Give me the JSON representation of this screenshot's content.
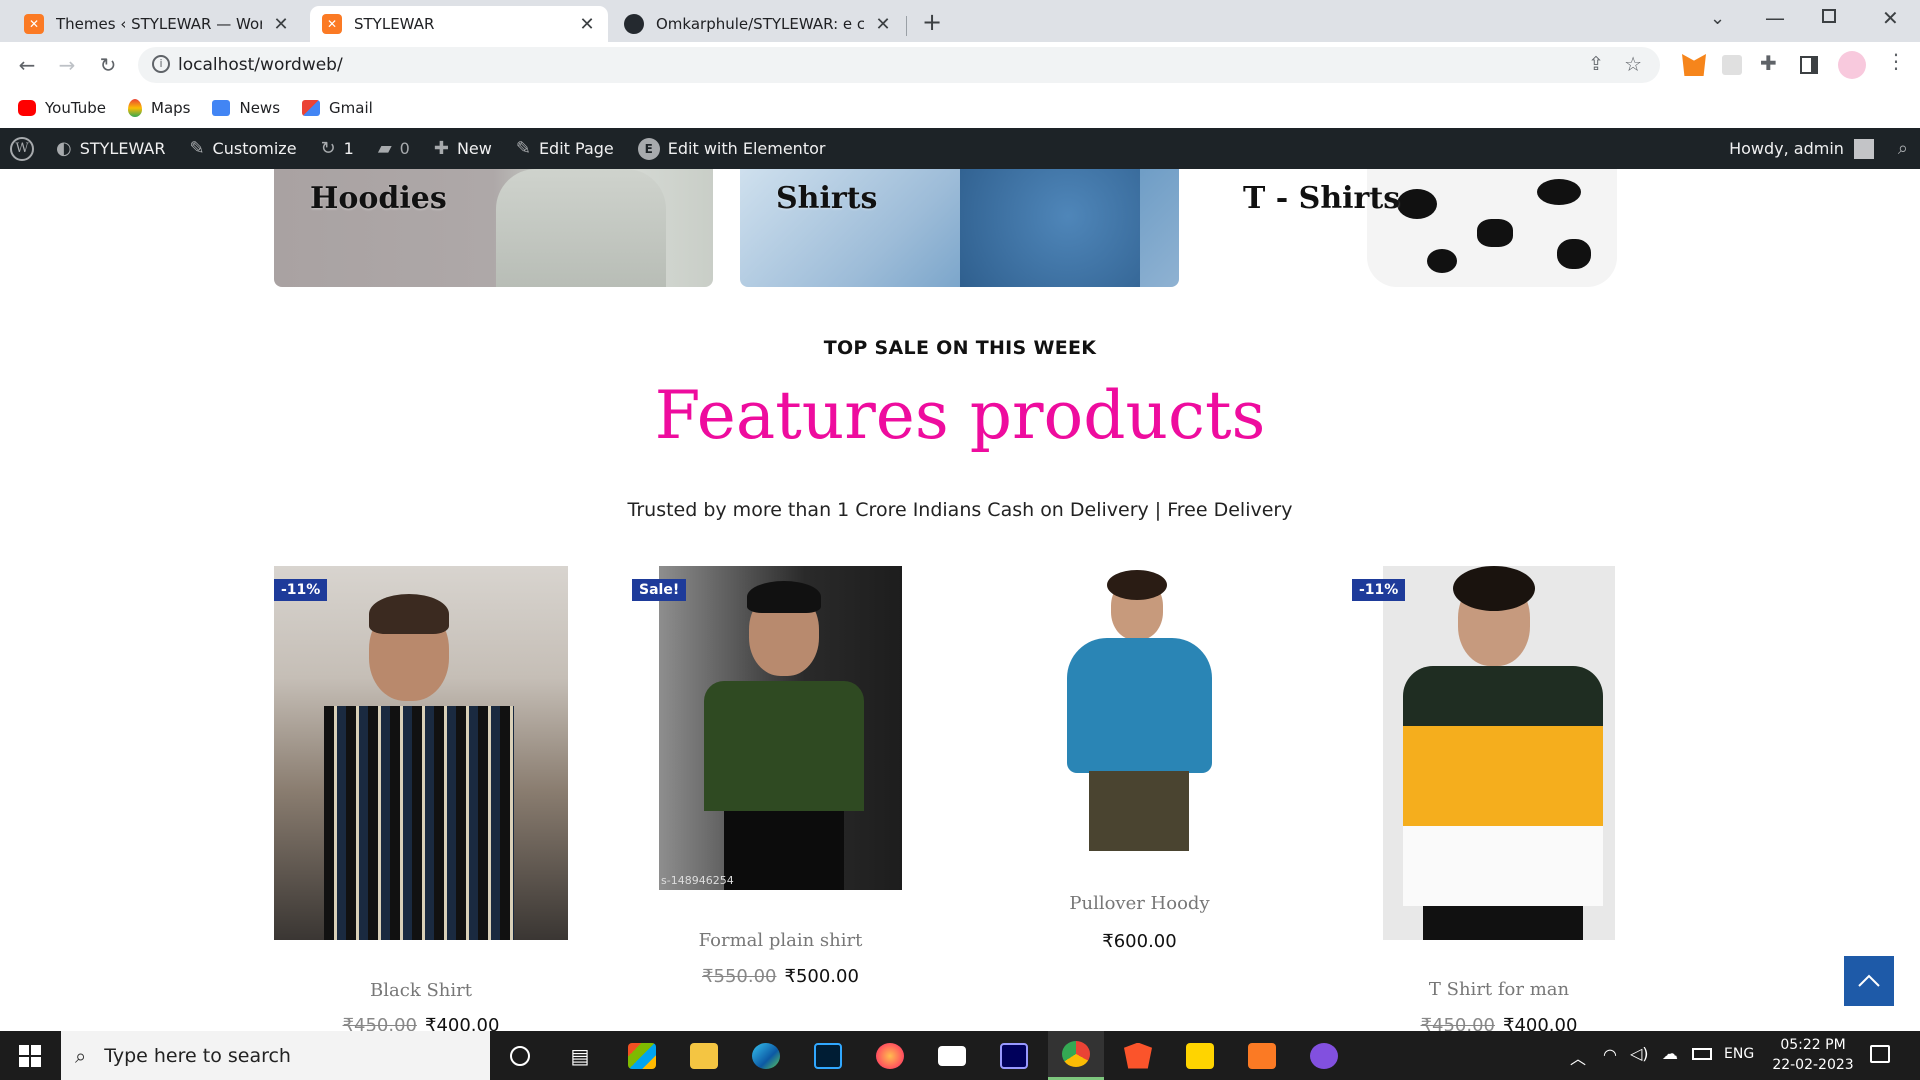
{
  "browser": {
    "tabs": [
      {
        "title": "Themes ‹ STYLEWAR — WordPress",
        "icon": "xampp-icon",
        "active": false
      },
      {
        "title": "STYLEWAR",
        "icon": "xampp-icon",
        "active": true
      },
      {
        "title": "Omkarphule/STYLEWAR: e commerce",
        "icon": "github-icon",
        "active": false
      }
    ],
    "url": "localhost/wordweb/",
    "bookmarks": [
      {
        "label": "YouTube",
        "icon": "youtube-icon"
      },
      {
        "label": "Maps",
        "icon": "maps-icon"
      },
      {
        "label": "News",
        "icon": "news-icon"
      },
      {
        "label": "Gmail",
        "icon": "gmail-icon"
      }
    ]
  },
  "adminbar": {
    "site": "STYLEWAR",
    "customize": "Customize",
    "updates": "1",
    "comments": "0",
    "new": "New",
    "edit_page": "Edit Page",
    "elementor": "Edit with Elementor",
    "howdy": "Howdy, admin"
  },
  "categories": [
    {
      "label": "Hoodies"
    },
    {
      "label": "Shirts"
    },
    {
      "label": "T - Shirts"
    }
  ],
  "section": {
    "kicker": "TOP SALE ON THIS WEEK",
    "heading": "Features products",
    "subtitle": "Trusted by more than 1 Crore Indians Cash on Delivery | Free Delivery"
  },
  "products": [
    {
      "name": "Black Shirt",
      "old_price": "₹450.00",
      "price": "₹400.00",
      "badge": "-11%"
    },
    {
      "name": "Formal plain shirt",
      "old_price": "₹550.00",
      "price": "₹500.00",
      "badge": "Sale!",
      "image_caption": "s-148946254"
    },
    {
      "name": "Pullover Hoody",
      "old_price": "",
      "price": "₹600.00",
      "badge": ""
    },
    {
      "name": "T Shirt for man",
      "old_price": "₹450.00",
      "price": "₹400.00",
      "badge": "-11%"
    }
  ],
  "colors": {
    "accent": "#ee0c9e",
    "badge": "#1e3b9a",
    "admin_bar": "#1d2327"
  },
  "taskbar": {
    "search_placeholder": "Type here to search",
    "language": "ENG",
    "time": "05:22 PM",
    "date": "22-02-2023"
  }
}
